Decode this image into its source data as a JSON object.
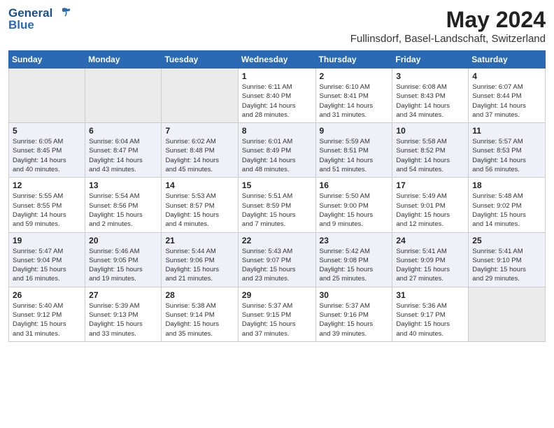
{
  "header": {
    "logo_general": "General",
    "logo_blue": "Blue",
    "month_title": "May 2024",
    "location": "Fullinsdorf, Basel-Landschaft, Switzerland"
  },
  "days_of_week": [
    "Sunday",
    "Monday",
    "Tuesday",
    "Wednesday",
    "Thursday",
    "Friday",
    "Saturday"
  ],
  "weeks": [
    [
      {
        "day": "",
        "info": ""
      },
      {
        "day": "",
        "info": ""
      },
      {
        "day": "",
        "info": ""
      },
      {
        "day": "1",
        "info": "Sunrise: 6:11 AM\nSunset: 8:40 PM\nDaylight: 14 hours\nand 28 minutes."
      },
      {
        "day": "2",
        "info": "Sunrise: 6:10 AM\nSunset: 8:41 PM\nDaylight: 14 hours\nand 31 minutes."
      },
      {
        "day": "3",
        "info": "Sunrise: 6:08 AM\nSunset: 8:43 PM\nDaylight: 14 hours\nand 34 minutes."
      },
      {
        "day": "4",
        "info": "Sunrise: 6:07 AM\nSunset: 8:44 PM\nDaylight: 14 hours\nand 37 minutes."
      }
    ],
    [
      {
        "day": "5",
        "info": "Sunrise: 6:05 AM\nSunset: 8:45 PM\nDaylight: 14 hours\nand 40 minutes."
      },
      {
        "day": "6",
        "info": "Sunrise: 6:04 AM\nSunset: 8:47 PM\nDaylight: 14 hours\nand 43 minutes."
      },
      {
        "day": "7",
        "info": "Sunrise: 6:02 AM\nSunset: 8:48 PM\nDaylight: 14 hours\nand 45 minutes."
      },
      {
        "day": "8",
        "info": "Sunrise: 6:01 AM\nSunset: 8:49 PM\nDaylight: 14 hours\nand 48 minutes."
      },
      {
        "day": "9",
        "info": "Sunrise: 5:59 AM\nSunset: 8:51 PM\nDaylight: 14 hours\nand 51 minutes."
      },
      {
        "day": "10",
        "info": "Sunrise: 5:58 AM\nSunset: 8:52 PM\nDaylight: 14 hours\nand 54 minutes."
      },
      {
        "day": "11",
        "info": "Sunrise: 5:57 AM\nSunset: 8:53 PM\nDaylight: 14 hours\nand 56 minutes."
      }
    ],
    [
      {
        "day": "12",
        "info": "Sunrise: 5:55 AM\nSunset: 8:55 PM\nDaylight: 14 hours\nand 59 minutes."
      },
      {
        "day": "13",
        "info": "Sunrise: 5:54 AM\nSunset: 8:56 PM\nDaylight: 15 hours\nand 2 minutes."
      },
      {
        "day": "14",
        "info": "Sunrise: 5:53 AM\nSunset: 8:57 PM\nDaylight: 15 hours\nand 4 minutes."
      },
      {
        "day": "15",
        "info": "Sunrise: 5:51 AM\nSunset: 8:59 PM\nDaylight: 15 hours\nand 7 minutes."
      },
      {
        "day": "16",
        "info": "Sunrise: 5:50 AM\nSunset: 9:00 PM\nDaylight: 15 hours\nand 9 minutes."
      },
      {
        "day": "17",
        "info": "Sunrise: 5:49 AM\nSunset: 9:01 PM\nDaylight: 15 hours\nand 12 minutes."
      },
      {
        "day": "18",
        "info": "Sunrise: 5:48 AM\nSunset: 9:02 PM\nDaylight: 15 hours\nand 14 minutes."
      }
    ],
    [
      {
        "day": "19",
        "info": "Sunrise: 5:47 AM\nSunset: 9:04 PM\nDaylight: 15 hours\nand 16 minutes."
      },
      {
        "day": "20",
        "info": "Sunrise: 5:46 AM\nSunset: 9:05 PM\nDaylight: 15 hours\nand 19 minutes."
      },
      {
        "day": "21",
        "info": "Sunrise: 5:44 AM\nSunset: 9:06 PM\nDaylight: 15 hours\nand 21 minutes."
      },
      {
        "day": "22",
        "info": "Sunrise: 5:43 AM\nSunset: 9:07 PM\nDaylight: 15 hours\nand 23 minutes."
      },
      {
        "day": "23",
        "info": "Sunrise: 5:42 AM\nSunset: 9:08 PM\nDaylight: 15 hours\nand 25 minutes."
      },
      {
        "day": "24",
        "info": "Sunrise: 5:41 AM\nSunset: 9:09 PM\nDaylight: 15 hours\nand 27 minutes."
      },
      {
        "day": "25",
        "info": "Sunrise: 5:41 AM\nSunset: 9:10 PM\nDaylight: 15 hours\nand 29 minutes."
      }
    ],
    [
      {
        "day": "26",
        "info": "Sunrise: 5:40 AM\nSunset: 9:12 PM\nDaylight: 15 hours\nand 31 minutes."
      },
      {
        "day": "27",
        "info": "Sunrise: 5:39 AM\nSunset: 9:13 PM\nDaylight: 15 hours\nand 33 minutes."
      },
      {
        "day": "28",
        "info": "Sunrise: 5:38 AM\nSunset: 9:14 PM\nDaylight: 15 hours\nand 35 minutes."
      },
      {
        "day": "29",
        "info": "Sunrise: 5:37 AM\nSunset: 9:15 PM\nDaylight: 15 hours\nand 37 minutes."
      },
      {
        "day": "30",
        "info": "Sunrise: 5:37 AM\nSunset: 9:16 PM\nDaylight: 15 hours\nand 39 minutes."
      },
      {
        "day": "31",
        "info": "Sunrise: 5:36 AM\nSunset: 9:17 PM\nDaylight: 15 hours\nand 40 minutes."
      },
      {
        "day": "",
        "info": ""
      }
    ]
  ]
}
